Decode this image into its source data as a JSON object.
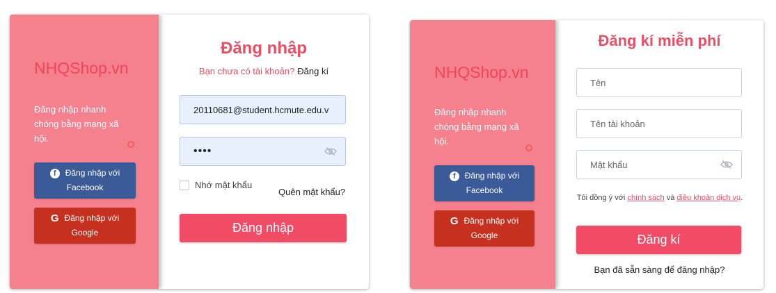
{
  "login": {
    "brand": "NHQShop.vn",
    "side_text": "Đăng nhập nhanh chóng bằng mạng xã hội.",
    "facebook_button": {
      "line1": "Đăng nhập với",
      "line2": "Facebook",
      "icon": "facebook-icon"
    },
    "google_button": {
      "line1": "Đăng nhập với",
      "line2": "Google",
      "icon": "google-icon"
    },
    "title": "Đăng nhập",
    "no_account_text": "Bạn chưa có tài khoản?",
    "register_link": "Đăng kí",
    "email_value": "20110681@student.hcmute.edu.v",
    "password_value": "••••",
    "remember_label": "Nhớ mật khẩu",
    "forgot_link": "Quên mật khẩu?",
    "submit_label": "Đăng nhập"
  },
  "signup": {
    "brand": "NHQShop.vn",
    "side_text": "Đăng nhập nhanh chóng bằng mạng xã hội.",
    "facebook_button": {
      "line1": "Đăng nhập với",
      "line2": "Facebook",
      "icon": "facebook-icon"
    },
    "google_button": {
      "line1": "Đăng nhập với",
      "line2": "Google",
      "icon": "google-icon"
    },
    "title": "Đăng kí miễn phí",
    "name_placeholder": "Tên",
    "username_placeholder": "Tên tài khoản",
    "password_placeholder": "Mật khẩu",
    "terms_prefix": "Tôi đồng ý với",
    "terms_policy": "chính sách",
    "terms_and": "và",
    "terms_conditions": "điều khoản dịch vụ",
    "terms_suffix": ".",
    "submit_label": "Đăng kí",
    "login_prompt": "Bạn đã sẵn sàng để đăng nhập?"
  },
  "colors": {
    "side_panel": "#f5818e",
    "brand": "#f0455a",
    "accent": "#f24b66",
    "facebook": "#3a5a98",
    "google": "#c5301f"
  }
}
